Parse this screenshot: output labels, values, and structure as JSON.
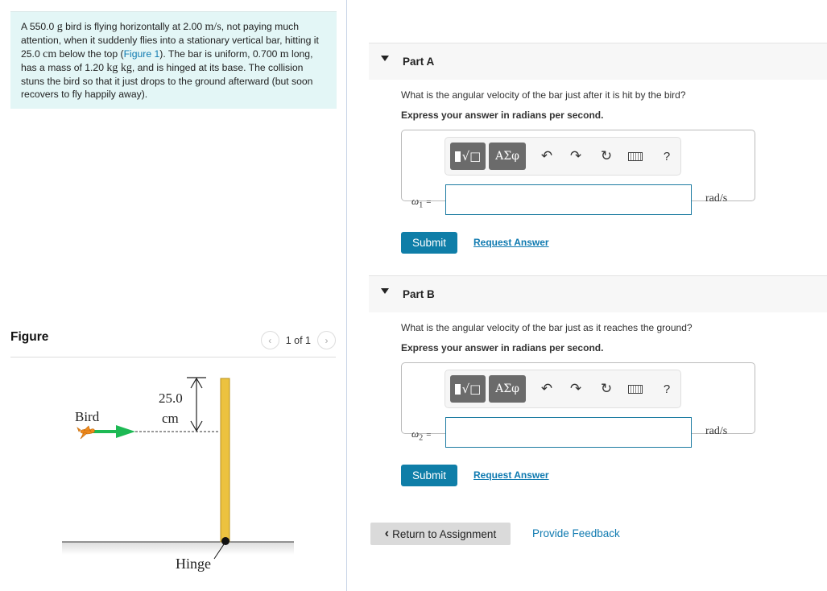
{
  "problem": {
    "segments": [
      {
        "t": "A 550.0 ",
        "math": false
      },
      {
        "t": "g",
        "math": true
      },
      {
        "t": " bird is flying horizontally at 2.00 ",
        "math": false
      },
      {
        "t": "m/s",
        "math": true
      },
      {
        "t": ", not paying much attention, when it suddenly flies into a stationary vertical bar, hitting it 25.0 ",
        "math": false
      },
      {
        "t": "cm",
        "math": true
      },
      {
        "t": " below the top (",
        "math": false
      },
      {
        "t": "Figure 1",
        "link": true
      },
      {
        "t": "). The bar is uniform, 0.700 ",
        "math": false
      },
      {
        "t": "m",
        "math": true
      },
      {
        "t": " long, has a mass of 1.20 ",
        "math": false
      },
      {
        "t": "kg kg",
        "math": true
      },
      {
        "t": ", and is hinged at its base. The collision stuns the bird so that it just drops to the ground afterward (but soon recovers to fly happily away).",
        "math": false
      }
    ]
  },
  "figure": {
    "title": "Figure",
    "pager": {
      "text": "1 of 1",
      "prev_icon": "chevron-left-icon",
      "next_icon": "chevron-right-icon"
    },
    "labels": {
      "bird": "Bird",
      "distance_value": "25.0",
      "distance_unit": "cm",
      "hinge": "Hinge"
    },
    "colors": {
      "bar_fill": "#ecc23f",
      "bar_stroke": "#b8901c",
      "arrow": "#1db954",
      "bird": "#f08a1c"
    }
  },
  "parts": [
    {
      "title": "Part A",
      "question": "What is the angular velocity of the bar just after it is hit by the bird?",
      "instruction": "Express your answer in radians per second.",
      "variable": "ω",
      "subscript": "1",
      "equals": "=",
      "input_value": "",
      "units": "rad/s",
      "submit_label": "Submit",
      "request_label": "Request Answer"
    },
    {
      "title": "Part B",
      "question": "What is the angular velocity of the bar just as it reaches the ground?",
      "instruction": "Express your answer in radians per second.",
      "variable": "ω",
      "subscript": "2",
      "equals": "=",
      "input_value": "",
      "units": "rad/s",
      "submit_label": "Submit",
      "request_label": "Request Answer"
    }
  ],
  "toolbar": {
    "templates_label": "√□",
    "greek_label": "ΑΣφ",
    "undo_glyph": "↶",
    "redo_glyph": "↷",
    "reset_glyph": "↻",
    "help_label": "?"
  },
  "footer": {
    "return_label": "Return to Assignment",
    "return_icon": "‹",
    "feedback_label": "Provide Feedback"
  }
}
